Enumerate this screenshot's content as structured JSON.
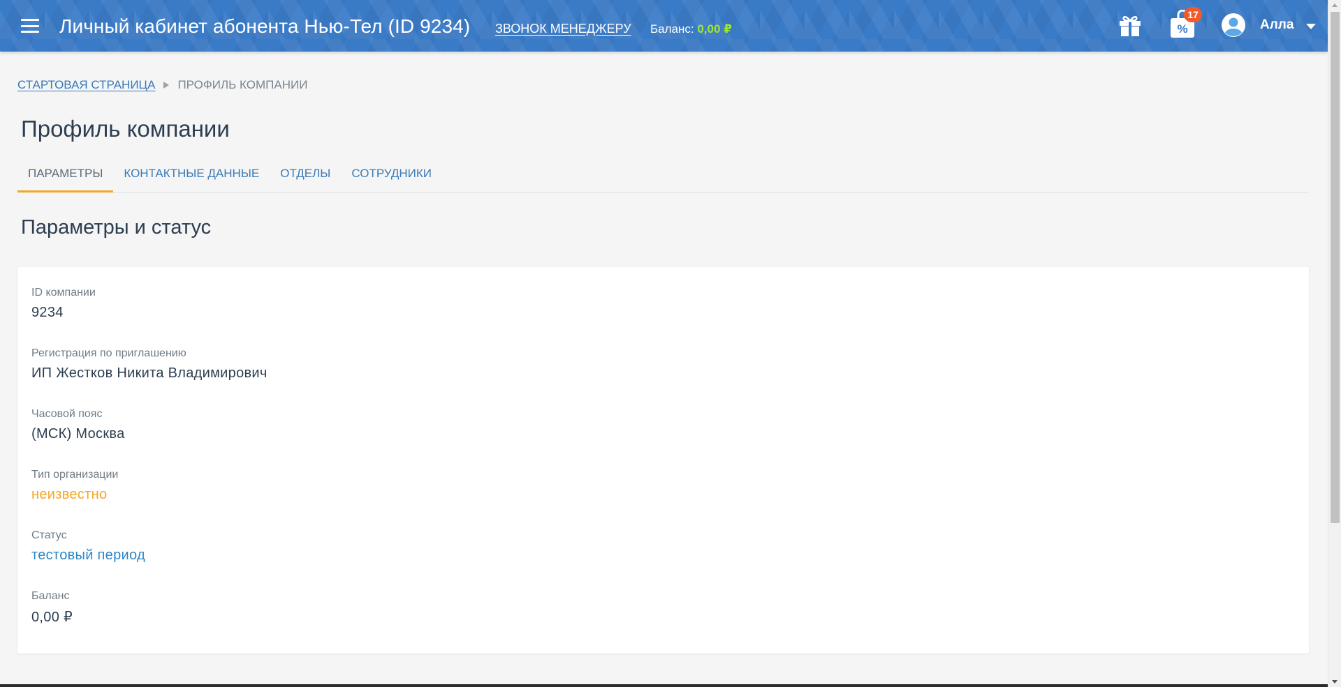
{
  "header": {
    "title": "Личный кабинет абонента Нью-Тел (ID 9234)",
    "call_manager": "ЗВОНОК МЕНЕДЖЕРУ",
    "balance_label": "Баланс:",
    "balance_value": "0,00 ₽",
    "promo_badge": "17",
    "promo_symbol": "%",
    "user_name": "Алла",
    "icons": [
      "menu-icon",
      "gift-icon",
      "promo-bag-icon",
      "user-avatar-icon",
      "chevron-down-icon"
    ]
  },
  "breadcrumb": {
    "home": "СТАРТОВАЯ СТРАНИЦА",
    "current": "ПРОФИЛЬ КОМПАНИИ"
  },
  "page": {
    "title": "Профиль компании",
    "section_title": "Параметры и статус"
  },
  "tabs": [
    {
      "label": "ПАРАМЕТРЫ",
      "active": true
    },
    {
      "label": "КОНТАКТНЫЕ ДАННЫЕ",
      "active": false
    },
    {
      "label": "ОТДЕЛЫ",
      "active": false
    },
    {
      "label": "СОТРУДНИКИ",
      "active": false
    }
  ],
  "fields": [
    {
      "label": "ID компании",
      "value": "9234"
    },
    {
      "label": "Регистрация по приглашению",
      "value": "ИП Жестков Никита Владимирович"
    },
    {
      "label": "Часовой пояс",
      "value": "(МСК) Москва"
    },
    {
      "label": "Тип организации",
      "value": "неизвестно"
    },
    {
      "label": "Статус",
      "value": "тестовый период"
    },
    {
      "label": "Баланс",
      "value": "0,00 ₽"
    }
  ],
  "colors": {
    "header_bg": "#3a7bc8",
    "balance_accent": "#9ee92b",
    "badge": "#f15a29",
    "active_tab_underline": "#f5a623",
    "warning_text": "#f5a623",
    "link_text": "#2b86c9"
  }
}
